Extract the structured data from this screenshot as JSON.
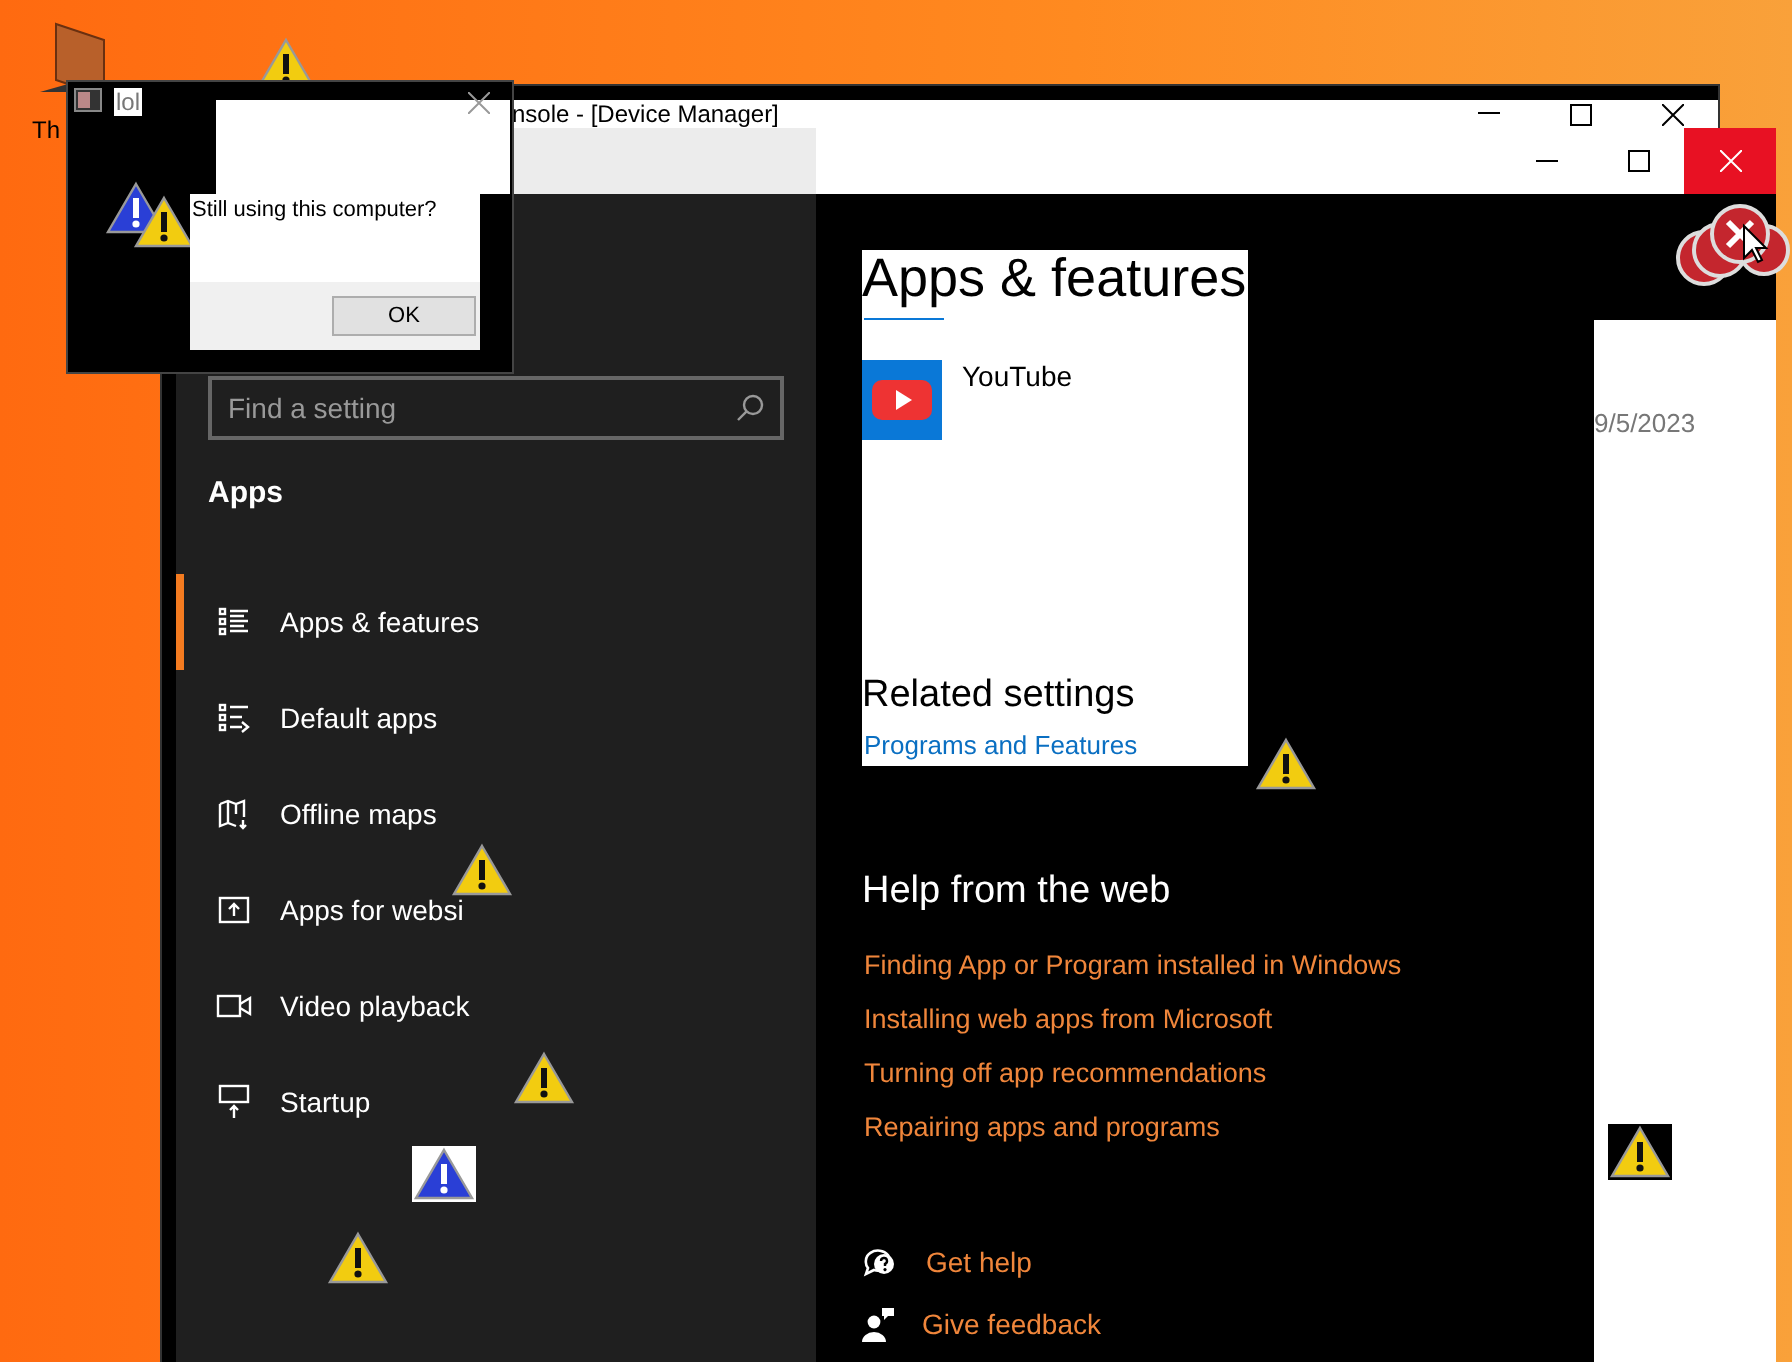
{
  "desktop": {
    "icon_label": "Th"
  },
  "dialog": {
    "title": "lol",
    "message": "Still using this computer?",
    "button": "OK"
  },
  "device_manager": {
    "title": "nsole - [Device Manager]"
  },
  "settings": {
    "search": {
      "placeholder": "Find a setting"
    },
    "section": "Apps",
    "nav": [
      {
        "kind": "list",
        "label": "Apps & features",
        "selected": true
      },
      {
        "kind": "defaults",
        "label": "Default apps",
        "selected": false
      },
      {
        "kind": "map",
        "label": "Offline maps",
        "selected": false
      },
      {
        "kind": "web",
        "label": "Apps for websi",
        "selected": false
      },
      {
        "kind": "video",
        "label": "Video playback",
        "selected": false
      },
      {
        "kind": "startup",
        "label": "Startup",
        "selected": false
      }
    ],
    "heading": "Apps & features",
    "apps": [
      {
        "name": "YouTube"
      }
    ],
    "date": "9/5/2023",
    "related_title": "Related settings",
    "related_links": [
      "Programs and Features"
    ],
    "help_title": "Help from the web",
    "help_links": [
      "Finding App or Program installed in Windows",
      "Installing web apps from Microsoft",
      "Turning off app recommendations",
      "Repairing apps and programs"
    ],
    "support": [
      {
        "kind": "help",
        "label": "Get help"
      },
      {
        "kind": "feedback",
        "label": "Give feedback"
      }
    ]
  }
}
